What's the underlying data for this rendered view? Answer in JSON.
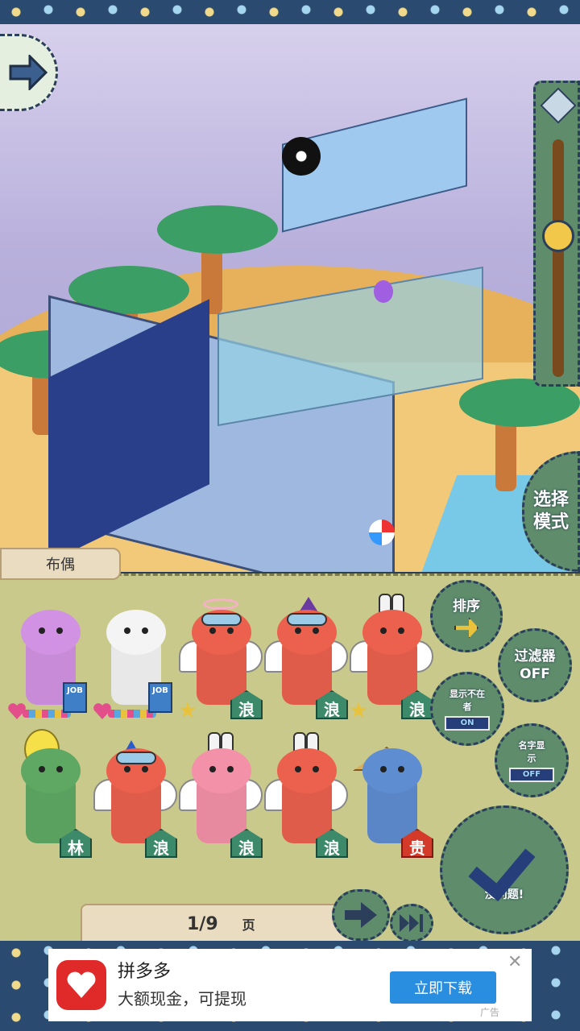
{
  "scene": {
    "select_mode_label": "选择模式"
  },
  "tab": {
    "label": "布偶"
  },
  "dolls": [
    {
      "kind": "heart-job",
      "color": "#c88bd8",
      "badge": "",
      "badge_red": false,
      "tag": "JOB"
    },
    {
      "kind": "heart-job",
      "color": "#e8e8e8",
      "badge": "",
      "badge_red": false,
      "tag": "JOB"
    },
    {
      "kind": "angel",
      "color": "#e05c4a",
      "badge": "浪",
      "badge_red": false,
      "tag": ""
    },
    {
      "kind": "witch",
      "color": "#e05c4a",
      "badge": "浪",
      "badge_red": false,
      "tag": ""
    },
    {
      "kind": "bunny",
      "color": "#e05c4a",
      "badge": "浪",
      "badge_red": false,
      "tag": ""
    },
    {
      "kind": "balloon",
      "color": "#5aa05e",
      "badge": "林",
      "badge_red": false,
      "tag": ""
    },
    {
      "kind": "party",
      "color": "#e05c4a",
      "badge": "浪",
      "badge_red": false,
      "tag": ""
    },
    {
      "kind": "bunny-angel",
      "color": "#e78aa0",
      "badge": "浪",
      "badge_red": false,
      "tag": ""
    },
    {
      "kind": "bunny-angel",
      "color": "#e05c4a",
      "badge": "浪",
      "badge_red": false,
      "tag": ""
    },
    {
      "kind": "straw",
      "color": "#5a86c8",
      "badge": "贵",
      "badge_red": true,
      "tag": ""
    }
  ],
  "controls": {
    "sort_label": "排序",
    "filter_label": "过滤器",
    "filter_state": "OFF",
    "show_absent_label": "显示不在者",
    "show_absent_state": "ON",
    "name_display_label": "名字显示",
    "name_display_state": "OFF",
    "ok_label": "没问题!"
  },
  "pager": {
    "current": "1/9",
    "unit": "页"
  },
  "ad": {
    "title": "拼多多",
    "subtitle": "大额现金，可提现",
    "cta": "立即下载",
    "close": "✕",
    "label": "广告"
  },
  "colors": {
    "panel": "#c9c98c",
    "button_green": "#5f8d6c",
    "house_green": "#3c8a6a",
    "house_red": "#d43a2a",
    "ad_cta": "#2a8ee0",
    "ad_logo": "#e02a2a"
  }
}
